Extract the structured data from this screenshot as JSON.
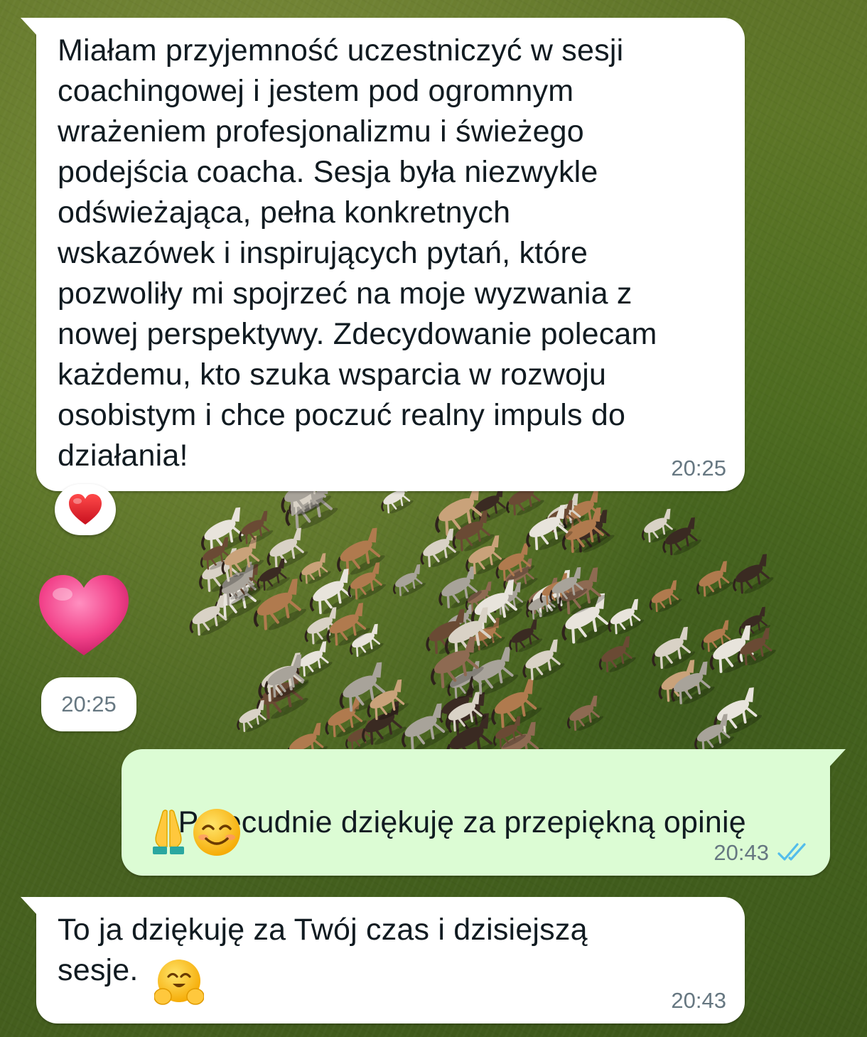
{
  "messages": [
    {
      "direction": "incoming",
      "text": "Miałam przyjemność uczestniczyć w sesji\ncoachingowej i jestem pod ogromnym\nwrażeniem profesjonalizmu i świeżego\npodejścia coacha. Sesja była niezwykle\nodświeżająca, pełna konkretnych\nwskazówek i inspirujących pytań, które\npozwoliły mi spojrzeć na moje wyzwania z\nnowej perspektywy. Zdecydowanie polecam\nkażdemu, kto szuka wsparcia w rozwoju\nosobistym i chce poczuć realny impuls do\ndziałania!",
      "time": "20:25",
      "reaction": "red-heart"
    },
    {
      "direction": "incoming",
      "type": "sticker",
      "sticker": "pink-heart",
      "time": "20:25"
    },
    {
      "direction": "outgoing",
      "text": "Przecudnie dziękuję za przepiękną opinię",
      "emojis": [
        "folded-hands",
        "smiling-face-with-smiling-eyes"
      ],
      "time": "20:43",
      "status": "read-double-check"
    },
    {
      "direction": "incoming",
      "text": "To ja dziękuję za Twój czas i dzisiejszą\nsesje. ",
      "emojis": [
        "hugging-face"
      ],
      "time": "20:43"
    }
  ],
  "colors": {
    "incoming_bubble": "#ffffff",
    "outgoing_bubble": "#dcfcd4",
    "text": "#111b21",
    "timestamp": "#667781",
    "read_ticks": "#53bdeb",
    "red_heart": "#e0202e",
    "pink_heart": "#f2428a"
  },
  "wallpaper": "green-meadow-with-running-horses"
}
